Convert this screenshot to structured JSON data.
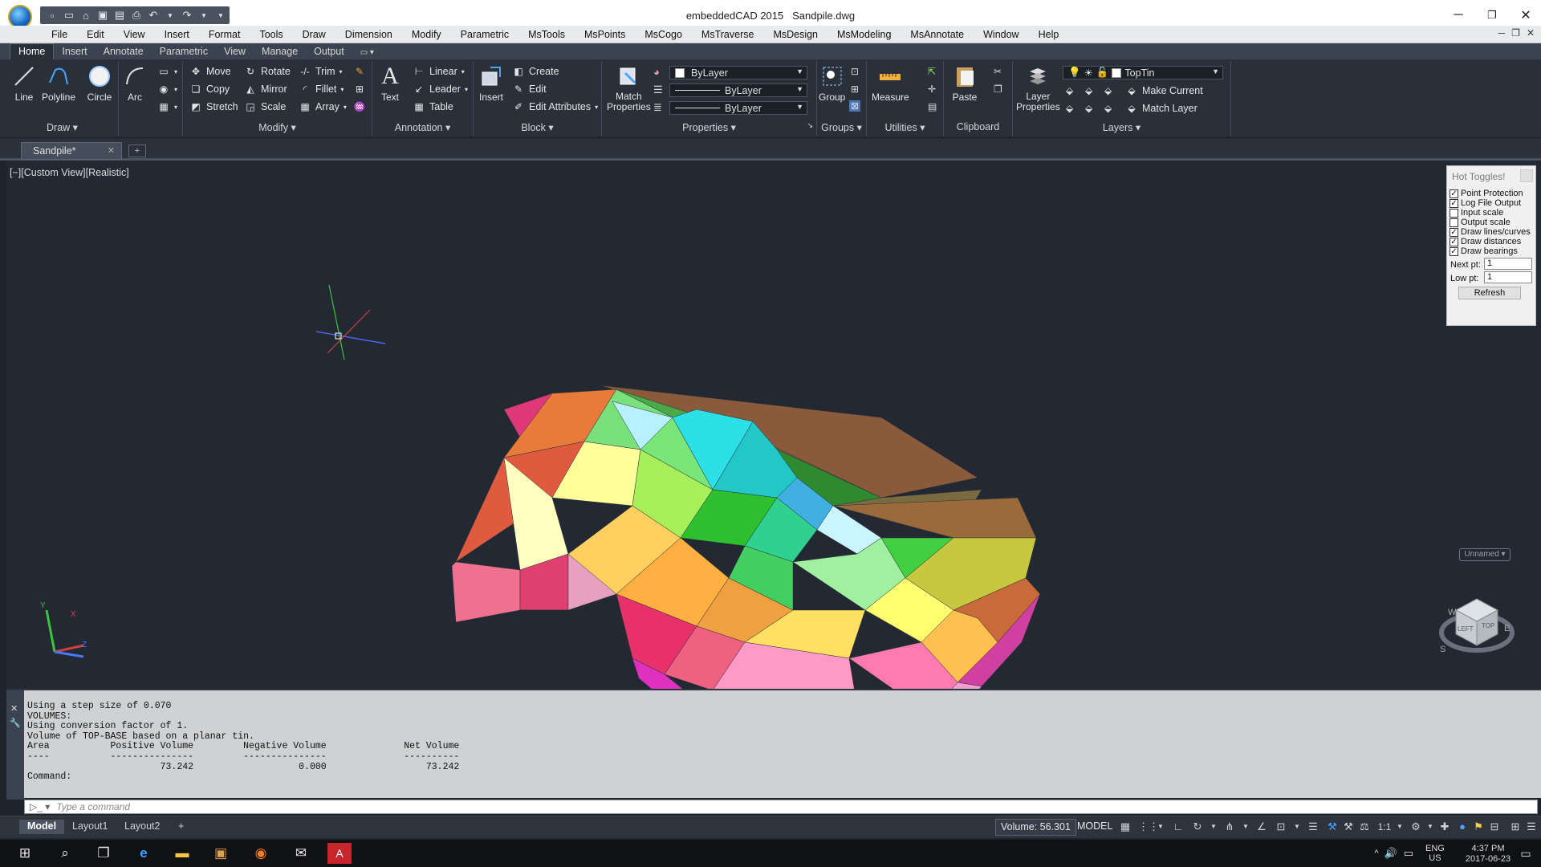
{
  "window": {
    "title": "embeddedCAD 2015",
    "filename": "Sandpile.dwg"
  },
  "qat_icons": [
    "new-icon",
    "open-icon",
    "open-folder-icon",
    "save-icon",
    "save-as-icon",
    "print-icon",
    "undo-icon",
    "redo-icon"
  ],
  "menu": [
    "File",
    "Edit",
    "View",
    "Insert",
    "Format",
    "Tools",
    "Draw",
    "Dimension",
    "Modify",
    "Parametric",
    "MsTools",
    "MsPoints",
    "MsCogo",
    "MsTraverse",
    "MsDesign",
    "MsModeling",
    "MsAnnotate",
    "Window",
    "Help"
  ],
  "ribbon_tabs": [
    "Home",
    "Insert",
    "Annotate",
    "Parametric",
    "View",
    "Manage",
    "Output"
  ],
  "ribbon": {
    "draw": {
      "panel": "Draw",
      "line": "Line",
      "polyline": "Polyline",
      "circle": "Circle",
      "arc": "Arc"
    },
    "modify": {
      "panel": "Modify",
      "move": "Move",
      "rotate": "Rotate",
      "trim": "Trim",
      "copy": "Copy",
      "mirror": "Mirror",
      "fillet": "Fillet",
      "stretch": "Stretch",
      "scale": "Scale",
      "array": "Array"
    },
    "annotation": {
      "panel": "Annotation",
      "text": "Text",
      "linear": "Linear",
      "leader": "Leader",
      "table": "Table"
    },
    "block": {
      "panel": "Block",
      "insert": "Insert",
      "create": "Create",
      "edit": "Edit",
      "edit_attributes": "Edit Attributes"
    },
    "properties": {
      "panel": "Properties",
      "match_line1": "Match",
      "match_line2": "Properties",
      "color": "ByLayer",
      "linetype": "ByLayer",
      "lineweight": "ByLayer"
    },
    "groups": {
      "panel": "Groups",
      "group": "Group"
    },
    "utilities": {
      "panel": "Utilities",
      "measure": "Measure"
    },
    "clipboard": {
      "panel": "Clipboard",
      "paste": "Paste"
    },
    "layers": {
      "panel": "Layers",
      "layer_line1": "Layer",
      "layer_line2": "Properties",
      "current_layer": "TopTin",
      "make_current": "Make Current",
      "match_layer": "Match Layer"
    }
  },
  "doc_tab": {
    "name": "Sandpile*"
  },
  "viewport": {
    "label": "[−][Custom View][Realistic]",
    "unnamed": "Unnamed"
  },
  "hot_toggles": {
    "title": "Hot Toggles!",
    "items": [
      {
        "label": "Point Protection",
        "checked": true
      },
      {
        "label": "Log File Output",
        "checked": true
      },
      {
        "label": "Input scale",
        "checked": false
      },
      {
        "label": "Output scale",
        "checked": false
      },
      {
        "label": "Draw lines/curves",
        "checked": true
      },
      {
        "label": "Draw distances",
        "checked": true
      },
      {
        "label": "Draw bearings",
        "checked": true
      }
    ],
    "next_pt_label": "Next pt:",
    "next_pt_value": "1",
    "low_pt_label": "Low pt:",
    "low_pt_value": "1",
    "refresh": "Refresh"
  },
  "command_log": [
    "Using a step size of 0.070",
    "VOLUMES:",
    "Using conversion factor of 1.",
    "Volume of TOP-BASE based on a planar tin.",
    "Area           Positive Volume         Negative Volume              Net Volume",
    "----           ---------------         ---------------              ----------",
    "                        73.242                   0.000                  73.242",
    "Command:"
  ],
  "command_input": {
    "placeholder": "Type a command"
  },
  "layout_tabs": [
    "Model",
    "Layout1",
    "Layout2"
  ],
  "status": {
    "volume": "Volume: 56.301",
    "space": "MODEL",
    "scale": "1:1"
  },
  "tray": {
    "lang1": "ENG",
    "lang2": "US",
    "time": "4:37 PM",
    "date": "2017-06-23"
  }
}
